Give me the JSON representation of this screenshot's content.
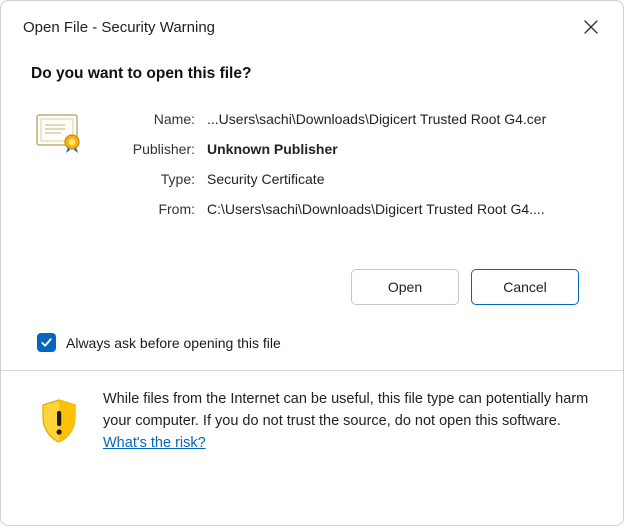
{
  "titlebar": {
    "title": "Open File - Security Warning"
  },
  "heading": "Do you want to open this file?",
  "fields": {
    "name_label": "Name:",
    "name_value": "...Users\\sachi\\Downloads\\Digicert Trusted Root G4.cer",
    "publisher_label": "Publisher:",
    "publisher_value": "Unknown Publisher",
    "type_label": "Type:",
    "type_value": "Security Certificate",
    "from_label": "From:",
    "from_value": "C:\\Users\\sachi\\Downloads\\Digicert Trusted Root G4...."
  },
  "buttons": {
    "open": "Open",
    "cancel": "Cancel"
  },
  "checkbox": {
    "label": "Always ask before opening this file",
    "checked": true
  },
  "footer": {
    "text": "While files from the Internet can be useful, this file type can potentially harm your computer. If you do not trust the source, do not open this software. ",
    "link": "What's the risk?"
  },
  "icons": {
    "close": "close-icon",
    "certificate": "certificate-icon",
    "warning_shield": "warning-shield-icon"
  }
}
